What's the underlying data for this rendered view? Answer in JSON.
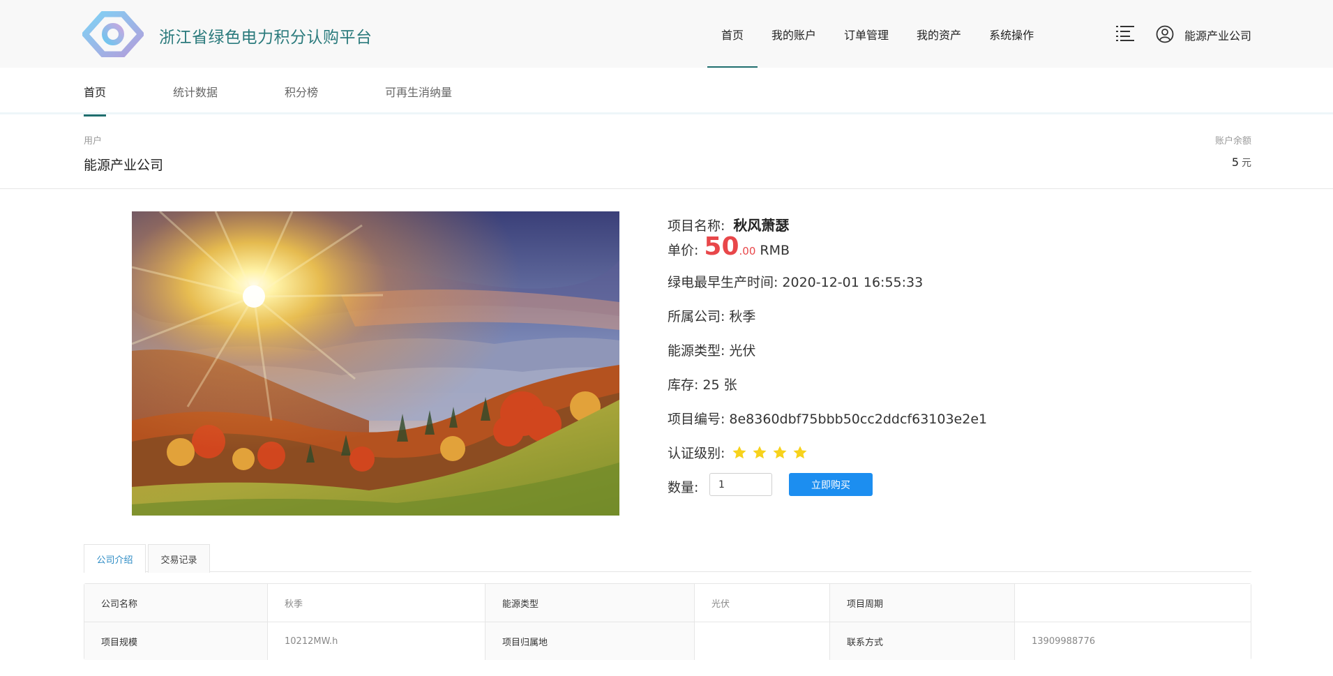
{
  "header": {
    "brand": "浙江省绿色电力积分认购平台",
    "nav": [
      "首页",
      "我的账户",
      "订单管理",
      "我的资产",
      "系统操作"
    ],
    "active_nav": 0,
    "user_name": "能源产业公司",
    "accent": "#1f6e6e"
  },
  "subtabs": [
    "首页",
    "统计数据",
    "积分榜",
    "可再生消纳量"
  ],
  "account": {
    "user_label": "用户",
    "user_value": "能源产业公司",
    "balance_label": "账户余额",
    "balance_value": "5",
    "balance_unit": "元"
  },
  "product": {
    "name_label": "项目名称:",
    "name_value": "秋风萧瑟",
    "price_label": "单价:",
    "price_int": "50",
    "price_dec": ".00",
    "price_currency": "RMB",
    "price_color": "#e8474a",
    "time_label": "绿电最早生产时间:",
    "time_value": "2020-12-01 16:55:33",
    "company_label": "所属公司:",
    "company_value": "秋季",
    "energy_label": "能源类型:",
    "energy_value": "光伏",
    "stock_label": "库存:",
    "stock_value": "25 张",
    "code_label": "项目编号:",
    "code_value": "8e8360dbf75bbb50cc2ddcf63103e2e1",
    "level_label": "认证级别:",
    "level_stars": 4,
    "star_color": "#f7d21b",
    "qty_label": "数量:",
    "qty_value": "1",
    "buy_label": "立即购买",
    "buy_color": "#1c8ef0"
  },
  "bottom_tabs": [
    "公司介绍",
    "交易记录"
  ],
  "details": {
    "rows": [
      [
        {
          "label": "公司名称",
          "value": "秋季"
        },
        {
          "label": "能源类型",
          "value": "光伏"
        },
        {
          "label": "项目周期",
          "value": ""
        }
      ],
      [
        {
          "label": "项目规模",
          "value": "10212MW.h"
        },
        {
          "label": "项目归属地",
          "value": ""
        },
        {
          "label": "联系方式",
          "value": "13909988776"
        }
      ]
    ]
  }
}
